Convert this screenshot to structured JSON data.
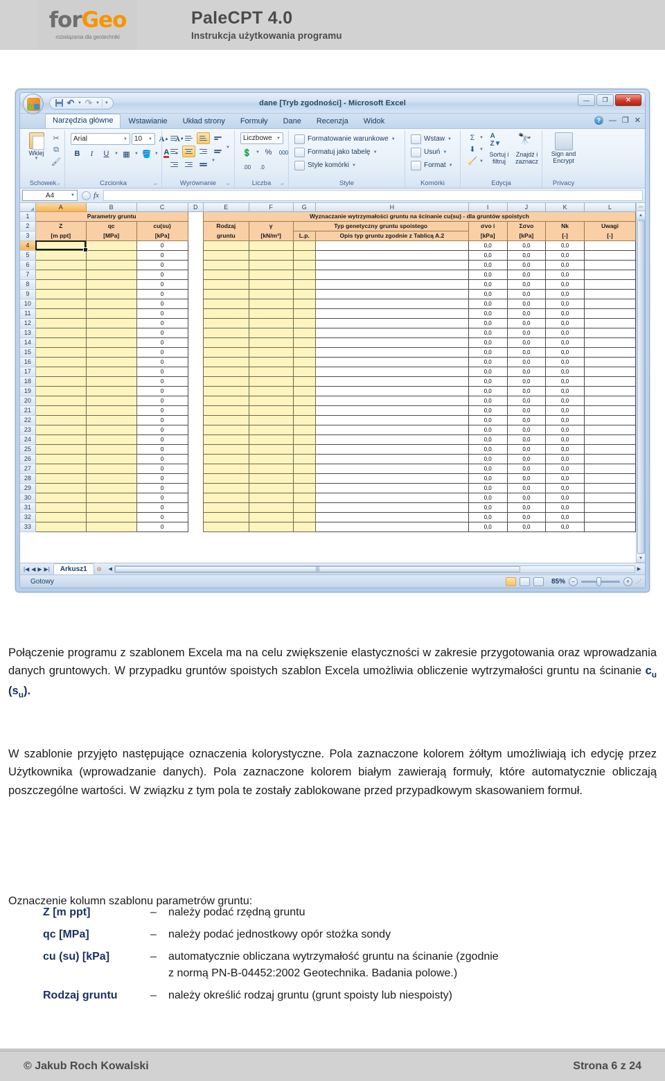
{
  "header": {
    "logo": {
      "part1": "for",
      "part2": "Geo",
      "tagline": "rozwiązania dla geotechniki"
    },
    "title": "PaleCPT 4.0",
    "subtitle": "Instrukcja użytkowania programu"
  },
  "excel": {
    "title_bar": "dane  [Tryb zgodności] - Microsoft Excel",
    "quick_access": [
      "save-icon",
      "undo-icon",
      "redo-icon",
      "customize-icon"
    ],
    "window_buttons": {
      "minimize": "—",
      "restore": "❐",
      "close": "✕"
    },
    "ribbon_tabs": [
      "Narzędzia główne",
      "Wstawianie",
      "Układ strony",
      "Formuły",
      "Dane",
      "Recenzja",
      "Widok"
    ],
    "active_tab": "Narzędzia główne",
    "groups": {
      "clipboard": {
        "label": "Schowek",
        "paste": "Wklej"
      },
      "font": {
        "label": "Czcionka",
        "font_name": "Arial",
        "font_size": "10",
        "bold": "B",
        "italic": "I",
        "underline": "U"
      },
      "alignment": {
        "label": "Wyrównanie"
      },
      "number": {
        "label": "Liczba",
        "format": "Liczbowe",
        "percent": "%",
        "thousands": "000"
      },
      "styles": {
        "label": "Style",
        "items": [
          "Formatowanie warunkowe",
          "Formatuj jako tabelę",
          "Style komórki"
        ]
      },
      "cells": {
        "label": "Komórki",
        "items": [
          "Wstaw",
          "Usuń",
          "Format"
        ]
      },
      "editing": {
        "label": "Edycja",
        "sort": "Sortuj i filtruj",
        "find": "Znajdź i zaznacz"
      },
      "privacy": {
        "label": "Privacy",
        "sign": "Sign and Encrypt"
      }
    },
    "name_box": "A4",
    "fx_label": "fx",
    "columns": [
      "A",
      "B",
      "C",
      "D",
      "E",
      "F",
      "G",
      "H",
      "I",
      "J",
      "K",
      "L"
    ],
    "selected_column": "A",
    "row_numbers": [
      1,
      2,
      3,
      4,
      5,
      6,
      7,
      8,
      9,
      10,
      11,
      12,
      13,
      14,
      15,
      16,
      17,
      18,
      19,
      20,
      21,
      22,
      23,
      24,
      25,
      26,
      27,
      28,
      29,
      30,
      31,
      32,
      33
    ],
    "selected_row": 4,
    "banner_left": "Parametry gruntu",
    "banner_right": "Wyznaczanie wytrzymałości gruntu na ścinanie cu(su) - dla gruntów spoistych",
    "headers": {
      "A": {
        "line1": "Z",
        "line2": "[m ppt]"
      },
      "B": {
        "line1": "qc",
        "line2": "[MPa]"
      },
      "C": {
        "line1": "cu(su)",
        "line2": "[kPa]"
      },
      "E": {
        "line1": "Rodzaj",
        "line2": "gruntu"
      },
      "F": {
        "line1": "γ",
        "line2": "[kN/m³]"
      },
      "GH": "Typ genetyczny gruntu spoistego",
      "G": "L.p.",
      "H": "Opis typ gruntu zgodnie z Tablicą A.2",
      "I": {
        "line1": "σvo i",
        "line2": "[kPa]"
      },
      "J": {
        "line1": "Σσvo",
        "line2": "[kPa]"
      },
      "K": {
        "line1": "Nk",
        "line2": "[-]"
      },
      "L": {
        "line1": "Uwagi",
        "line2": "[-]"
      }
    },
    "cell_values": {
      "C": "0",
      "I": "0,0",
      "J": "0,0",
      "K": "0,0"
    },
    "data_row_count": 30,
    "sheet_tab": "Arkusz1",
    "status": "Gotowy",
    "zoom": "85%"
  },
  "body": {
    "p1_a": "Połączenie programu z szablonem Excela ma na celu zwiększenie elastyczności w zakresie przygotowania oraz wprowadzania danych gruntowych. W przypadku gruntów spoistych szablon Excela umożliwia obliczenie wytrzymałości gruntu na ścinanie ",
    "p1_sym_c": "c",
    "p1_sym_cu": "u",
    "p1_sym_open": " (",
    "p1_sym_s": "s",
    "p1_sym_su": "u",
    "p1_sym_close": ").",
    "p2": "W szablonie przyjęto następujące oznaczenia kolorystyczne. Pola zaznaczone kolorem żółtym umożliwiają ich edycję przez Użytkownika (wprowadzanie danych). Pola zaznaczone kolorem białym zawierają formuły, które automatycznie obliczają poszczególne wartości. W związku z tym pola te zostały zablokowane przed przypadkowym skasowaniem formuł.",
    "p3": "Oznaczenie kolumn szablonu parametrów gruntu:"
  },
  "definitions": [
    {
      "term": "Z [m ppt]",
      "dash": "–",
      "desc": "należy podać rzędną gruntu",
      "cont": ""
    },
    {
      "term": "qc [MPa]",
      "dash": "–",
      "desc": "należy podać jednostkowy opór stożka sondy",
      "cont": ""
    },
    {
      "term": "cu (su) [kPa]",
      "dash": "–",
      "desc": "automatycznie obliczana wytrzymałość gruntu na ścinanie (zgodnie",
      "cont": "z normą PN-B-04452:2002 Geotechnika. Badania polowe.)"
    },
    {
      "term": "Rodzaj gruntu",
      "dash": "–",
      "desc": "należy określić rodzaj gruntu (grunt spoisty lub niespoisty)",
      "cont": ""
    }
  ],
  "footer": {
    "copyright": "© Jakub Roch Kowalski",
    "page": "Strona 6 z 24"
  }
}
